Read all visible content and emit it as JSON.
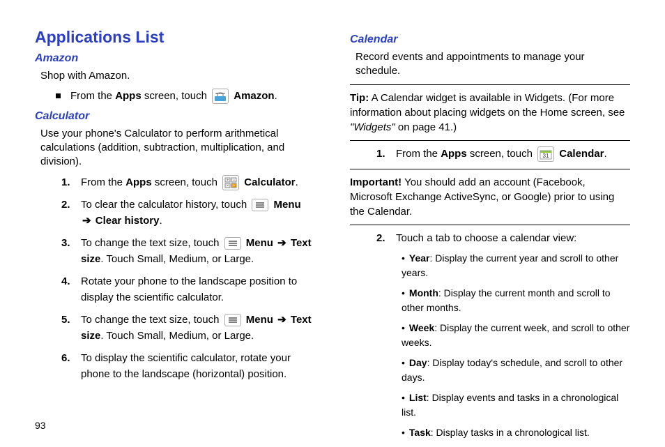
{
  "page_number": "93",
  "left": {
    "title": "Applications List",
    "amazon": {
      "heading": "Amazon",
      "desc": "Shop with Amazon.",
      "step_prefix": "From the ",
      "apps_bold": "Apps",
      "step_mid": " screen, touch ",
      "amazon_bold": "Amazon",
      "period": "."
    },
    "calculator": {
      "heading": "Calculator",
      "desc": "Use your phone's Calculator to perform arithmetical calculations (addition, subtraction, multiplication, and division).",
      "steps": [
        {
          "num": "1.",
          "pre": "From the ",
          "b1": "Apps",
          "mid": " screen, touch ",
          "b2": "Calculator",
          "tail": "."
        },
        {
          "num": "2.",
          "pre": "To clear the calculator history, touch ",
          "b1": "Menu",
          "arrow": "➔",
          "b2": "Clear history",
          "tail": "."
        },
        {
          "num": "3.",
          "pre": "To change the text size, touch ",
          "b1": "Menu",
          "arrow": "➔",
          "b2": "Text size",
          "tail": ". Touch Small, Medium, or Large."
        },
        {
          "num": "4.",
          "text": "Rotate your phone to the landscape position to display the scientific calculator."
        },
        {
          "num": "5.",
          "pre": "To change the text size, touch ",
          "b1": "Menu",
          "arrow": "➔",
          "b2": "Text size",
          "tail": ". Touch Small, Medium, or Large."
        },
        {
          "num": "6.",
          "text": "To display the scientific calculator, rotate your phone to the landscape (horizontal) position."
        }
      ]
    }
  },
  "right": {
    "calendar": {
      "heading": "Calendar",
      "desc": "Record events and appointments to manage your schedule.",
      "tip": {
        "label": "Tip:",
        "body_pre": "A Calendar widget is available in Widgets. (For more information about placing widgets on the Home screen, see ",
        "ref": "\"Widgets\"",
        "body_post": " on page 41.)"
      },
      "step1": {
        "num": "1.",
        "pre": "From the ",
        "b1": "Apps",
        "mid": " screen, touch ",
        "b2": "Calendar",
        "tail": "."
      },
      "important": {
        "label": "Important!",
        "body": "You should add an account (Facebook, Microsoft Exchange ActiveSync, or Google) prior to using the Calendar."
      },
      "step2": {
        "num": "2.",
        "text": "Touch a tab to choose a calendar view:",
        "bullets": [
          {
            "b": "Year",
            "t": ": Display the current year and scroll to other years."
          },
          {
            "b": "Month",
            "t": ": Display the current month and scroll to other months."
          },
          {
            "b": "Week",
            "t": ": Display the current week, and scroll to other weeks."
          },
          {
            "b": "Day",
            "t": ": Display today's schedule, and scroll to other days."
          },
          {
            "b": "List",
            "t": ": Display events and tasks in a chronological list."
          },
          {
            "b": "Task",
            "t": ": Display tasks in a chronological list."
          }
        ]
      }
    }
  }
}
